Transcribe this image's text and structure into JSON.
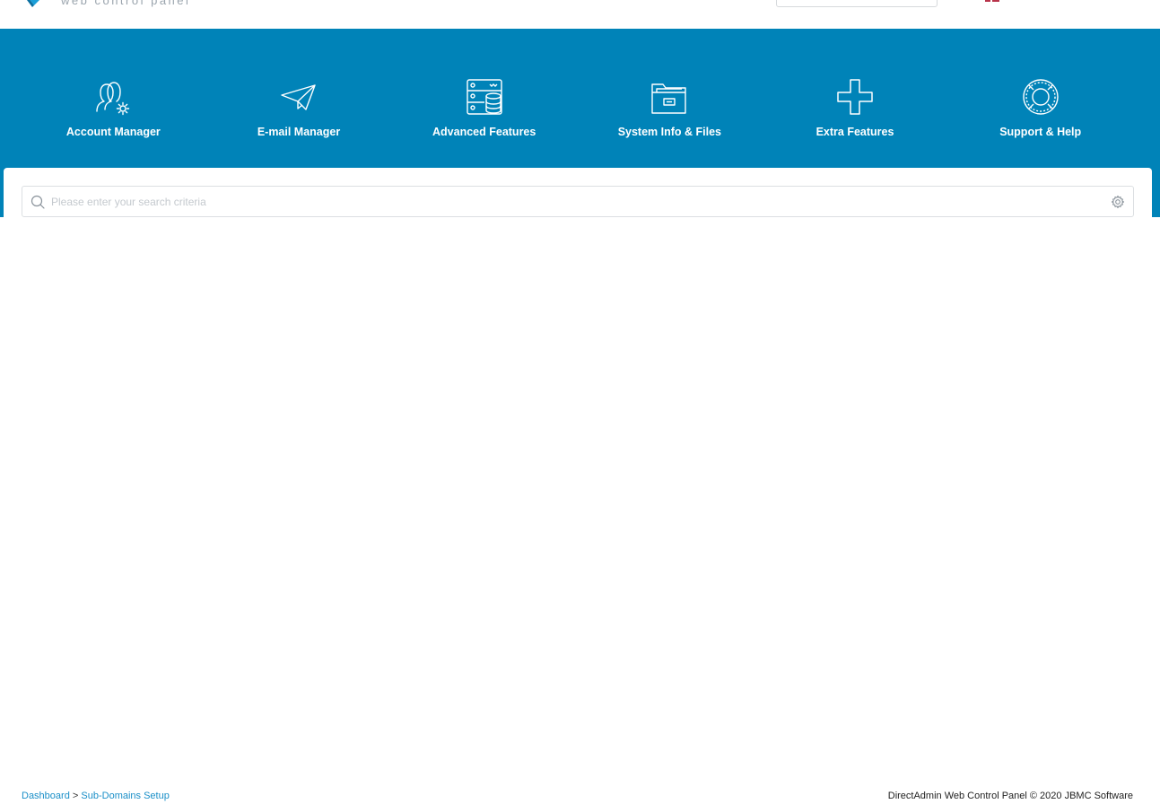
{
  "header": {
    "logo_text": "web control panel"
  },
  "nav": {
    "items": [
      {
        "label": "Account Manager",
        "icon": "users-gear-icon"
      },
      {
        "label": "E-mail Manager",
        "icon": "paper-plane-icon"
      },
      {
        "label": "Advanced Features",
        "icon": "server-database-icon"
      },
      {
        "label": "System Info & Files",
        "icon": "folder-icon"
      },
      {
        "label": "Extra Features",
        "icon": "plus-icon"
      },
      {
        "label": "Support & Help",
        "icon": "lifebuoy-icon"
      }
    ]
  },
  "search": {
    "placeholder": "Please enter your search criteria",
    "value": ""
  },
  "footer": {
    "breadcrumb": {
      "home": "Dashboard",
      "separator": ">",
      "current": "Sub-Domains Setup"
    },
    "copyright": "DirectAdmin Web Control Panel © 2020 JBMC Software"
  },
  "colors": {
    "brand_blue": "#0083b8",
    "link_blue": "#1a8fc8"
  }
}
